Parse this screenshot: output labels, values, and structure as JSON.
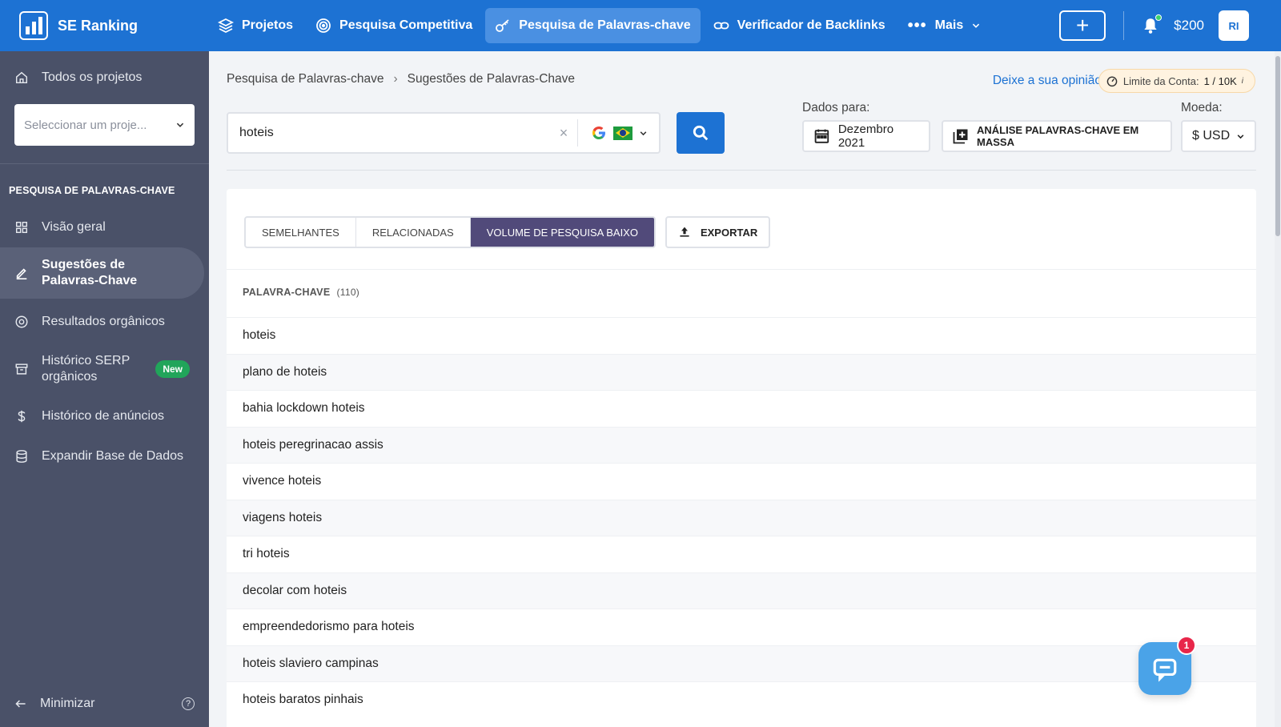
{
  "app": {
    "name": "SE Ranking"
  },
  "nav": {
    "items": [
      {
        "label": "Projetos",
        "icon": "layers-icon"
      },
      {
        "label": "Pesquisa Competitiva",
        "icon": "target-icon"
      },
      {
        "label": "Pesquisa de Palavras-chave",
        "icon": "key-icon",
        "active": true
      },
      {
        "label": "Verificador de Backlinks",
        "icon": "link-icon"
      },
      {
        "label": "Mais",
        "icon": "more-icon"
      }
    ],
    "plus_label": "+",
    "balance": "$200",
    "avatar": "RI"
  },
  "sidebar": {
    "all_projects": "Todos os projetos",
    "project_placeholder": "Seleccionar um proje...",
    "section_heading": "PESQUISA DE PALAVRAS-CHAVE",
    "items": [
      {
        "label": "Visão geral",
        "icon": "grid-icon"
      },
      {
        "label": "Sugestões de Palavras-Chave",
        "icon": "edit-icon",
        "active": true
      },
      {
        "label": "Resultados orgânicos",
        "icon": "circle-target-icon"
      },
      {
        "label": "Histórico SERP orgânicos",
        "icon": "archive-icon",
        "badge": "New"
      },
      {
        "label": "Histórico de anúncios",
        "icon": "dollar-icon"
      },
      {
        "label": "Expandir Base de Dados",
        "icon": "database-icon"
      }
    ],
    "minimize": "Minimizar"
  },
  "breadcrumb": {
    "parent": "Pesquisa de Palavras-chave",
    "separator": "›",
    "current": "Sugestões de Palavras-Chave"
  },
  "header": {
    "feedback": "Deixe a sua opinião",
    "limit_label": "Limite da Conta:",
    "limit_value": "1 / 10K",
    "limit_info": "i"
  },
  "search": {
    "value": "hoteis",
    "clear": "×",
    "engine": "google-icon",
    "country": "brazil-flag-icon"
  },
  "filters": {
    "data_label": "Dados para:",
    "date": "Dezembro 2021",
    "bulk": "ANÁLISE PALAVRAS-CHAVE EM MASSA",
    "currency_label": "Moeda:",
    "currency": "$ USD"
  },
  "tabs": [
    {
      "label": "SEMELHANTES"
    },
    {
      "label": "RELACIONADAS"
    },
    {
      "label": "VOLUME DE PESQUISA BAIXO",
      "active": true
    }
  ],
  "export_label": "EXPORTAR",
  "table": {
    "column": "PALAVRA-CHAVE",
    "count": "(110)",
    "rows": [
      "hoteis",
      "plano de hoteis",
      "bahia lockdown hoteis",
      "hoteis peregrinacao assis",
      "vivence hoteis",
      "viagens hoteis",
      "tri hoteis",
      "decolar com hoteis",
      "empreendedorismo para hoteis",
      "hoteis slaviero campinas",
      "hoteis baratos pinhais"
    ]
  },
  "chat": {
    "count": "1"
  },
  "colors": {
    "brand": "#1d72d3",
    "sidebar": "#4a5168",
    "active_tab": "#514a7a",
    "badge_new": "#21a55a"
  }
}
